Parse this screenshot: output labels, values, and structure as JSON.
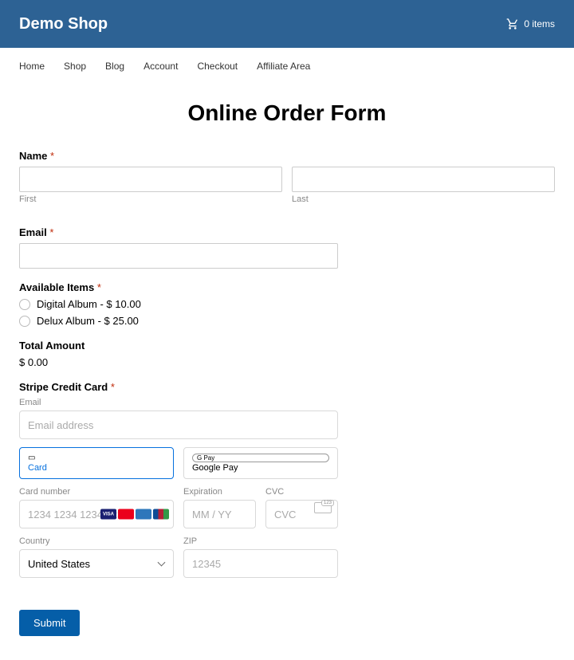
{
  "header": {
    "logo": "Demo Shop",
    "cart_count": "0 items"
  },
  "nav": [
    "Home",
    "Shop",
    "Blog",
    "Account",
    "Checkout",
    "Affiliate Area"
  ],
  "form": {
    "title": "Online Order Form",
    "name": {
      "label": "Name",
      "first_sub": "First",
      "last_sub": "Last"
    },
    "email": {
      "label": "Email"
    },
    "items": {
      "label": "Available Items",
      "options": [
        "Digital Album - $ 10.00",
        "Delux Album - $ 25.00"
      ]
    },
    "total": {
      "label": "Total Amount",
      "value": "$ 0.00"
    },
    "stripe": {
      "label": "Stripe Credit Card",
      "email_label": "Email",
      "email_placeholder": "Email address",
      "card_tab": "Card",
      "gpay_tab": "Google Pay",
      "gpay_badge": "G Pay",
      "card_number_label": "Card number",
      "card_number_placeholder": "1234 1234 1234 1234",
      "expiration_label": "Expiration",
      "expiration_placeholder": "MM / YY",
      "cvc_label": "CVC",
      "cvc_placeholder": "CVC",
      "country_label": "Country",
      "country_value": "United States",
      "zip_label": "ZIP",
      "zip_placeholder": "12345"
    },
    "submit": "Submit"
  }
}
